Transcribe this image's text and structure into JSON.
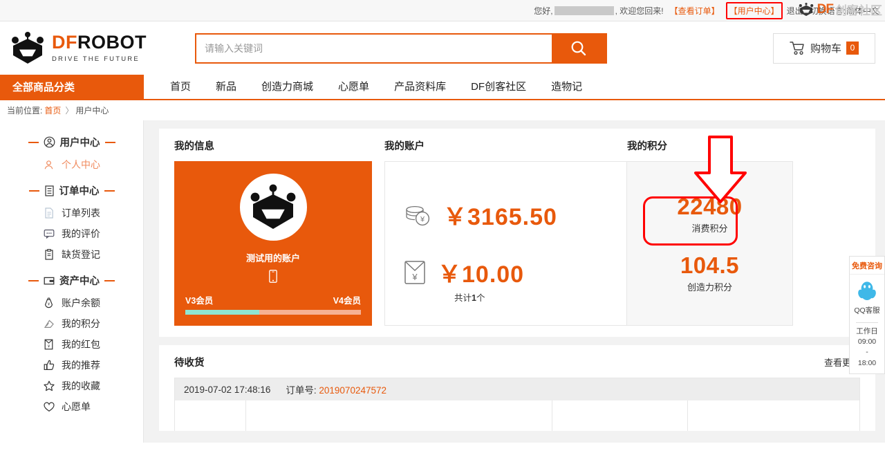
{
  "topbar": {
    "greeting": "您好,",
    "welcome": ", 欢迎您回来!",
    "view_orders": "【查看订单】",
    "user_center": "【用户中心】",
    "logout": "退出",
    "lang_label": "切换语言:",
    "lang_value": "简体中文",
    "watermark_df": "DF",
    "watermark_cn": "创客社区"
  },
  "header": {
    "logo_df": "DF",
    "logo_robot": "ROBOT",
    "logo_tagline": "DRIVE THE FUTURE",
    "search_placeholder": "请输入关键词",
    "search_value": "",
    "cart_label": "购物车",
    "cart_count": "0"
  },
  "nav": {
    "all_categories": "全部商品分类",
    "items": [
      {
        "label": "首页"
      },
      {
        "label": "新品"
      },
      {
        "label": "创造力商城"
      },
      {
        "label": "心愿单"
      },
      {
        "label": "产品资料库"
      },
      {
        "label": "DF创客社区"
      },
      {
        "label": "造物记"
      }
    ]
  },
  "breadcrumb": {
    "prefix": "当前位置:",
    "home": "首页",
    "separator": "〉",
    "current": "用户中心"
  },
  "sidebar": {
    "groups": [
      {
        "title": "用户中心",
        "icon": "user-circle-icon",
        "items": [
          {
            "label": "个人中心",
            "icon": "person-icon",
            "active": true
          }
        ]
      },
      {
        "title": "订单中心",
        "icon": "order-list-icon",
        "items": [
          {
            "label": "订单列表",
            "icon": "document-icon",
            "active": false
          },
          {
            "label": "我的评价",
            "icon": "comment-icon",
            "active": false
          },
          {
            "label": "缺货登记",
            "icon": "clipboard-icon",
            "active": false
          }
        ]
      },
      {
        "title": "资产中心",
        "icon": "wallet-icon",
        "items": [
          {
            "label": "账户余额",
            "icon": "coin-bag-icon",
            "active": false
          },
          {
            "label": "我的积分",
            "icon": "points-icon",
            "active": false
          },
          {
            "label": "我的红包",
            "icon": "red-packet-icon",
            "active": false
          },
          {
            "label": "我的推荐",
            "icon": "thumbs-up-icon",
            "active": false
          },
          {
            "label": "我的收藏",
            "icon": "star-icon",
            "active": false
          },
          {
            "label": "心愿单",
            "icon": "heart-icon",
            "active": false
          }
        ]
      }
    ]
  },
  "my_info": {
    "title": "我的信息",
    "username": "测试用的账户",
    "avatar_icon": "dfrobot-avatar-icon",
    "phone_icon": "phone-icon",
    "level_current": "V3会员",
    "level_next": "V4会员",
    "progress_percent": 42
  },
  "my_account": {
    "title": "我的账户",
    "balance_icon": "coins-icon",
    "balance": "￥3165.50",
    "coupon_icon": "red-packet-envelope-icon",
    "coupon": "￥10.00",
    "coupon_count_prefix": "共计",
    "coupon_count": "1",
    "coupon_count_suffix": "个"
  },
  "my_points": {
    "title": "我的积分",
    "consume_points": "22480",
    "consume_label": "消费积分",
    "creative_points": "104.5",
    "creative_label": "创造力积分",
    "highlight_color": "#ff0000"
  },
  "orders": {
    "title": "待收货",
    "more_label": "查看更多",
    "rows": [
      {
        "datetime": "2019-07-02 17:48:16",
        "order_no_label": "订单号:",
        "order_no": "2019070247572"
      }
    ]
  },
  "service_rail": {
    "header": "免费咨询",
    "qq_icon": "qq-penguin-icon",
    "qq_label": "QQ客服",
    "workday": "工作日",
    "time_start": "09:00",
    "time_dash": "-",
    "time_end": "18:00"
  },
  "colors": {
    "brand_orange": "#e8590c",
    "annotation_red": "#ff0000",
    "progress_fill": "#8fe6d2",
    "progress_track": "#f6b194"
  }
}
